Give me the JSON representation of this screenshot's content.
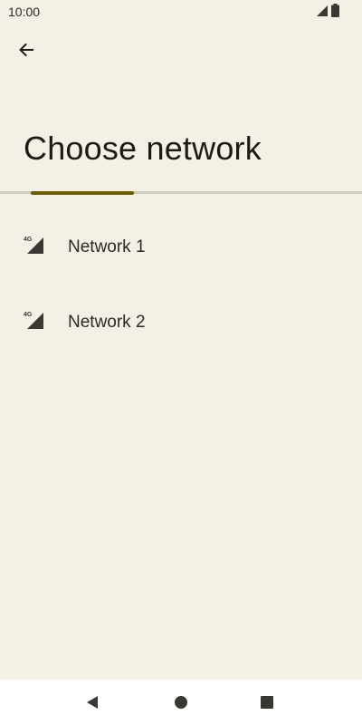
{
  "status_bar": {
    "time": "10:00",
    "signal_icon": "signal-icon",
    "battery_icon": "battery-icon"
  },
  "header": {
    "back_icon": "arrow-back-icon",
    "title": "Choose network"
  },
  "progress": {
    "indeterminate": true
  },
  "networks": [
    {
      "label": "Network 1",
      "icon": "signal-4g-icon",
      "badge": "4G"
    },
    {
      "label": "Network 2",
      "icon": "signal-4g-icon",
      "badge": "4G"
    }
  ],
  "nav_bar": {
    "back_icon": "nav-back-icon",
    "home_icon": "nav-home-icon",
    "recents_icon": "nav-recents-icon"
  },
  "colors": {
    "background": "#f5f0e6",
    "accent": "#6b5d00",
    "text": "#1d1b16",
    "track": "#cfcab9"
  }
}
